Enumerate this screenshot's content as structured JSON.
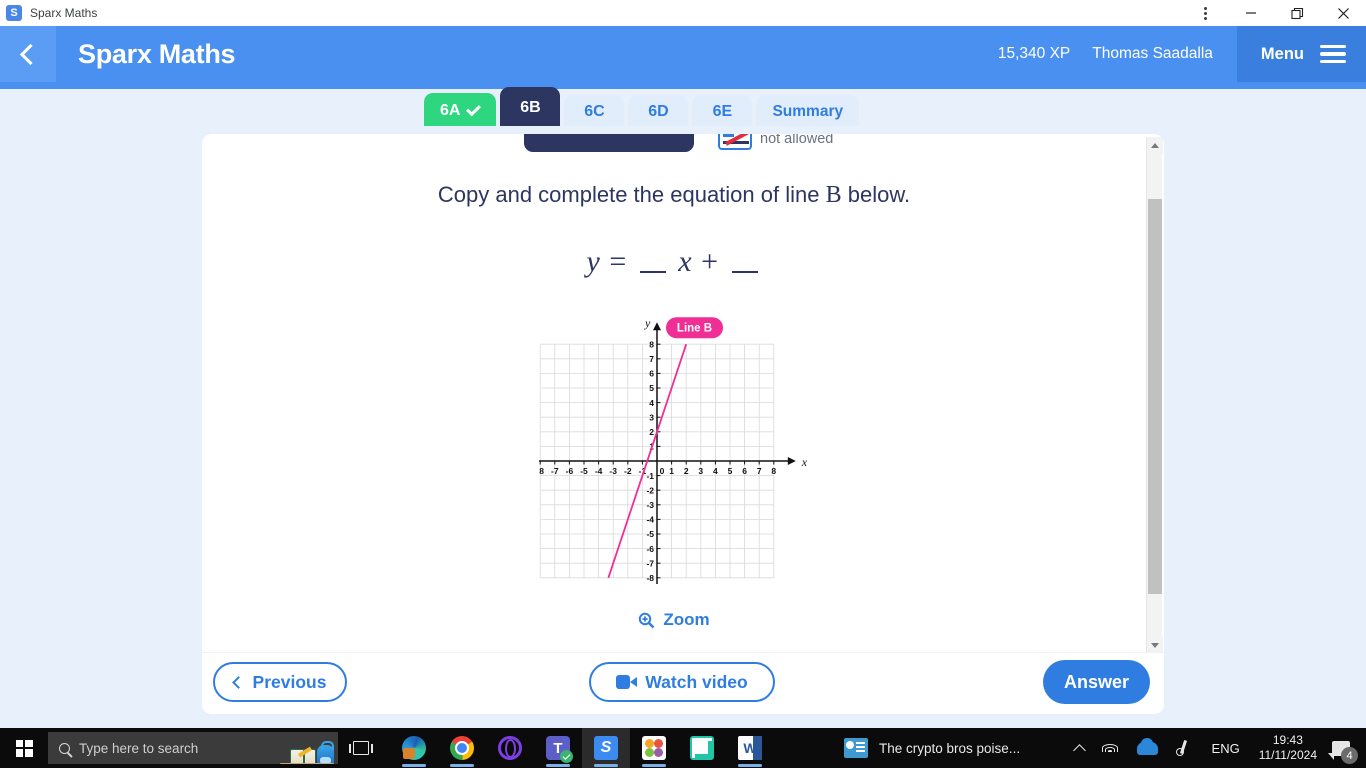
{
  "browser": {
    "tab_title": "Sparx Maths",
    "favicon_letter": "S",
    "controls": {
      "menu": "⋮",
      "minimize": "—",
      "restore": "❐",
      "close": "✕"
    }
  },
  "header": {
    "back_icon": "chevron-left-icon",
    "title": "Sparx Maths",
    "xp": "15,340 XP",
    "user": "Thomas Saadalla",
    "menu_label": "Menu",
    "burger_icon": "hamburger-icon",
    "bg_color": "#4a90f0",
    "menu_bg_color": "#3a7fdd"
  },
  "tabs": [
    {
      "label": "6A",
      "state": "completed",
      "check": true,
      "color": "#2ed67f"
    },
    {
      "label": "6B",
      "state": "active",
      "check": false,
      "color": "#2d3561"
    },
    {
      "label": "6C",
      "state": "default",
      "check": false,
      "color": "#2f7de1"
    },
    {
      "label": "6D",
      "state": "default",
      "check": false,
      "color": "#2f7de1"
    },
    {
      "label": "6E",
      "state": "default",
      "check": false,
      "color": "#2f7de1"
    },
    {
      "label": "Summary",
      "state": "default",
      "check": false,
      "color": "#2f7de1"
    }
  ],
  "question": {
    "calculator_note": "not allowed",
    "prompt_before": "Copy and complete the equation of line ",
    "prompt_var": "B",
    "prompt_after": " below.",
    "equation": {
      "lhs": "y",
      "equals": "=",
      "blank1": "",
      "var": "x",
      "plus": "+",
      "blank2": ""
    },
    "zoom_label": "Zoom",
    "zoom_icon": "zoom-in-icon"
  },
  "chart_data": {
    "type": "line",
    "title": "Line B",
    "xlabel": "x",
    "ylabel": "y",
    "xlim": [
      -8,
      8
    ],
    "ylim": [
      -8,
      8
    ],
    "xticks": [
      -8,
      -7,
      -6,
      -5,
      -4,
      -3,
      -2,
      -1,
      0,
      1,
      2,
      3,
      4,
      5,
      6,
      7,
      8
    ],
    "yticks": [
      -8,
      -7,
      -6,
      -5,
      -4,
      -3,
      -2,
      -1,
      1,
      2,
      3,
      4,
      5,
      6,
      7,
      8
    ],
    "grid": true,
    "grid_color": "#d9d9d9",
    "line_color": "#ef2f96",
    "label_badge": "Line B",
    "label_badge_color": "#ef2f96",
    "series": [
      {
        "name": "Line B",
        "slope": 3,
        "intercept": 2,
        "points": [
          [
            -3.33,
            -8
          ],
          [
            0,
            2
          ],
          [
            2,
            8
          ]
        ],
        "x_intercept": -0.67,
        "y_intercept": 2
      }
    ]
  },
  "footer": {
    "previous_label": "Previous",
    "previous_icon": "chevron-left-icon",
    "watch_video_label": "Watch video",
    "watch_video_icon": "video-camera-icon",
    "answer_label": "Answer",
    "answer_bg": "#2f7de1"
  },
  "taskbar": {
    "start_icon": "windows-start-icon",
    "search_placeholder": "Type here to search",
    "search_icon": "search-icon",
    "task_view_icon": "task-view-icon",
    "apps": [
      {
        "name": "edge",
        "label": "Microsoft Edge",
        "active": false,
        "running": true
      },
      {
        "name": "chrome",
        "label": "Google Chrome",
        "active": false,
        "running": true
      },
      {
        "name": "opera",
        "label": "Opera",
        "active": false,
        "running": false
      },
      {
        "name": "teams",
        "label": "Microsoft Teams",
        "active": false,
        "running": true
      },
      {
        "name": "sparx",
        "label": "Sparx Maths",
        "active": true,
        "running": true
      },
      {
        "name": "flower",
        "label": "Photos",
        "active": false,
        "running": true
      },
      {
        "name": "mint",
        "label": "App",
        "active": false,
        "running": false
      },
      {
        "name": "word",
        "label": "Microsoft Word",
        "active": false,
        "running": true
      }
    ],
    "news": {
      "text": "The crypto bros poise...",
      "icon": "news-icon"
    },
    "tray": {
      "overflow_icon": "chevron-up-icon",
      "wifi_icon": "wifi-icon",
      "onedrive_icon": "onedrive-cloud-icon",
      "pen_icon": "pen-ink-icon",
      "language": "ENG",
      "time": "19:43",
      "date": "11/11/2024",
      "notifications_icon": "notifications-icon",
      "notification_count": "4"
    }
  }
}
